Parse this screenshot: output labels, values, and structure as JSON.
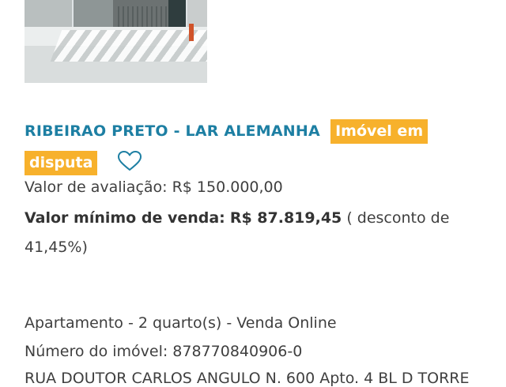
{
  "listing": {
    "title": "RIBEIRAO PRETO - LAR ALEMANHA",
    "badge": "Imóvel em disputa",
    "appraisal": "Valor de avaliação: R$ 150.000,00",
    "min_sale_label": "Valor mínimo de venda:",
    "min_sale_value": "R$ 87.819,45",
    "discount": "( desconto de 41,45%)",
    "property_type": "Apartamento - 2 quarto(s) - Venda Online",
    "property_number": "Número do imóvel: 878770840906-0",
    "address_partial": "RUA DOUTOR CARLOS ANGULO N. 600 Apto. 4 BL D TORRE"
  },
  "icons": {
    "favorite": "heart-outline-icon"
  },
  "colors": {
    "title": "#1d7fa3",
    "badge_bg": "#f7b12c",
    "badge_text": "#ffffff"
  }
}
